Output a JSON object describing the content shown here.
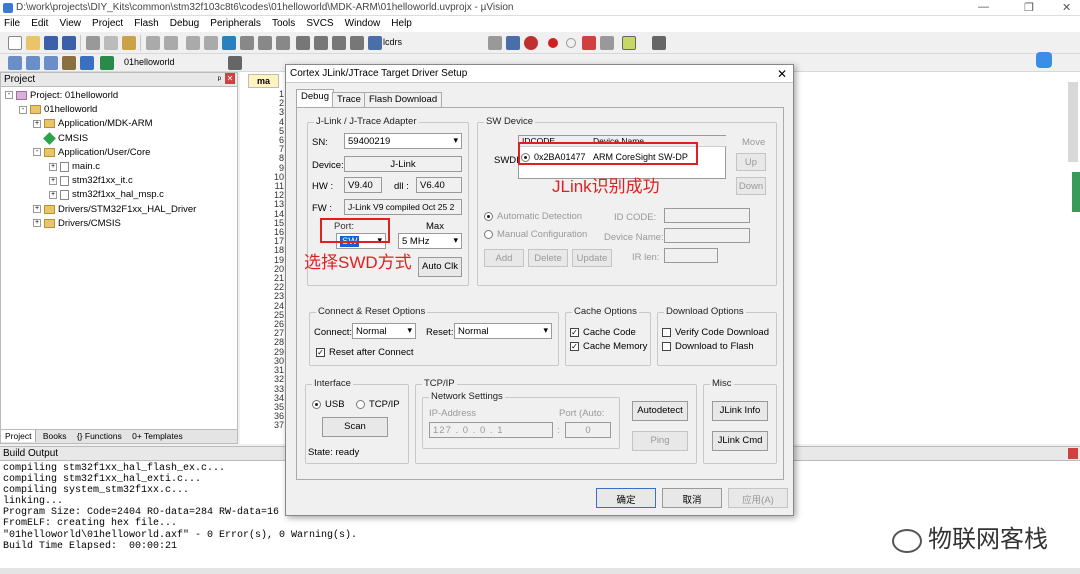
{
  "window": {
    "title": "D:\\work\\projects\\DIY_Kits\\common\\stm32f103c8t6\\codes\\01helloworld\\MDK-ARM\\01helloworld.uvprojx - µVision",
    "min": "—",
    "max": "❐",
    "close": "✕"
  },
  "menu": [
    "File",
    "Edit",
    "View",
    "Project",
    "Flash",
    "Debug",
    "Peripherals",
    "Tools",
    "SVCS",
    "Window",
    "Help"
  ],
  "toolbar": {
    "find_value": "lcdrs",
    "target": "01helloworld"
  },
  "project": {
    "header": "Project",
    "pin": "ᵖ",
    "close": "✕",
    "root": "Project: 01helloworld",
    "target": "01helloworld",
    "groups": [
      {
        "name": "Application/MDK-ARM"
      },
      {
        "name": "CMSIS"
      },
      {
        "name": "Application/User/Core"
      },
      {
        "name": "main.c"
      },
      {
        "name": "stm32f1xx_it.c"
      },
      {
        "name": "stm32f1xx_hal_msp.c"
      },
      {
        "name": "Drivers/STM32F1xx_HAL_Driver"
      },
      {
        "name": "Drivers/CMSIS"
      }
    ],
    "tabs": [
      "Project",
      "Books",
      "{} Functions",
      "0+ Templates"
    ]
  },
  "editor": {
    "tab": "ma",
    "lines": [
      "1",
      "2",
      "3",
      "4",
      "5",
      "6",
      "7",
      "8",
      "9",
      "10",
      "11",
      "12",
      "13",
      "14",
      "15",
      "16",
      "17",
      "18",
      "19",
      "20",
      "21",
      "22",
      "23",
      "24",
      "25",
      "26",
      "27",
      "28",
      "29",
      "30",
      "31",
      "32",
      "33",
      "34",
      "35",
      "36",
      "37"
    ]
  },
  "build": {
    "header": "Build Output",
    "lines": [
      "compiling stm32f1xx_hal_flash_ex.c...",
      "compiling stm32f1xx_hal_exti.c...",
      "compiling system_stm32f1xx.c...",
      "linking...",
      "Program Size: Code=2404 RO-data=284 RW-data=16 ZI-data=1632",
      "FromELF: creating hex file...",
      "\"01helloworld\\01helloworld.axf\" - 0 Error(s), 0 Warning(s).",
      "Build Time Elapsed:  00:00:21"
    ]
  },
  "dialog": {
    "title": "Cortex JLink/JTrace Target Driver Setup",
    "close": "✕",
    "tabs": [
      "Debug",
      "Trace",
      "Flash Download"
    ],
    "adapter": {
      "legend": "J-Link / J-Trace Adapter",
      "sn_label": "SN:",
      "sn_value": "59400219",
      "device_label": "Device:",
      "device_value": "J-Link",
      "hw_label": "HW :",
      "hw_value": "V9.40",
      "dll_label": "dll :",
      "dll_value": "V6.40",
      "fw_label": "FW :",
      "fw_value": "J-Link V9 compiled Oct 25 2",
      "port_label": "Port:",
      "port_value": "SW",
      "max_label": "Max",
      "max_value": "5 MHz",
      "auto_clk": "Auto Clk"
    },
    "swdevice": {
      "legend": "SW Device",
      "col_idcode": "IDCODE",
      "col_device": "Device Name",
      "row_label": "SWDI",
      "row_idcode": "0x2BA01477",
      "row_device": "ARM CoreSight SW-DP",
      "move": "Move",
      "up": "Up",
      "down": "Down",
      "auto_detect": "Automatic Detection",
      "manual": "Manual Configuration",
      "id_code": "ID CODE:",
      "device_name": "Device Name:",
      "ir_len": "IR len:",
      "add": "Add",
      "delete": "Delete",
      "update": "Update"
    },
    "connect": {
      "legend": "Connect & Reset Options",
      "connect_label": "Connect:",
      "connect_value": "Normal",
      "reset_label": "Reset:",
      "reset_value": "Normal",
      "reset_after": "Reset after Connect"
    },
    "cache": {
      "legend": "Cache Options",
      "code": "Cache Code",
      "memory": "Cache Memory"
    },
    "download": {
      "legend": "Download Options",
      "verify": "Verify Code Download",
      "flash": "Download to Flash"
    },
    "interface": {
      "legend": "Interface",
      "usb": "USB",
      "tcpip": "TCP/IP",
      "scan": "Scan",
      "state": "State: ready"
    },
    "tcpip": {
      "legend": "TCP/IP",
      "network": "Network Settings",
      "ip_label": "IP-Address",
      "ip": [
        "127",
        "0",
        "0",
        "1"
      ],
      "port_label": "Port (Auto:",
      "port_value": "0",
      "autodetect": "Autodetect",
      "ping": "Ping"
    },
    "misc": {
      "legend": "Misc",
      "jlink_info": "JLink Info",
      "jlink_cmd": "JLink Cmd"
    },
    "ok": "确定",
    "cancel": "取消",
    "apply": "应用(A)"
  },
  "annotations": {
    "jlink_ok": "JLink识别成功",
    "swd": "选择SWD方式"
  },
  "watermark": "物联网客栈"
}
